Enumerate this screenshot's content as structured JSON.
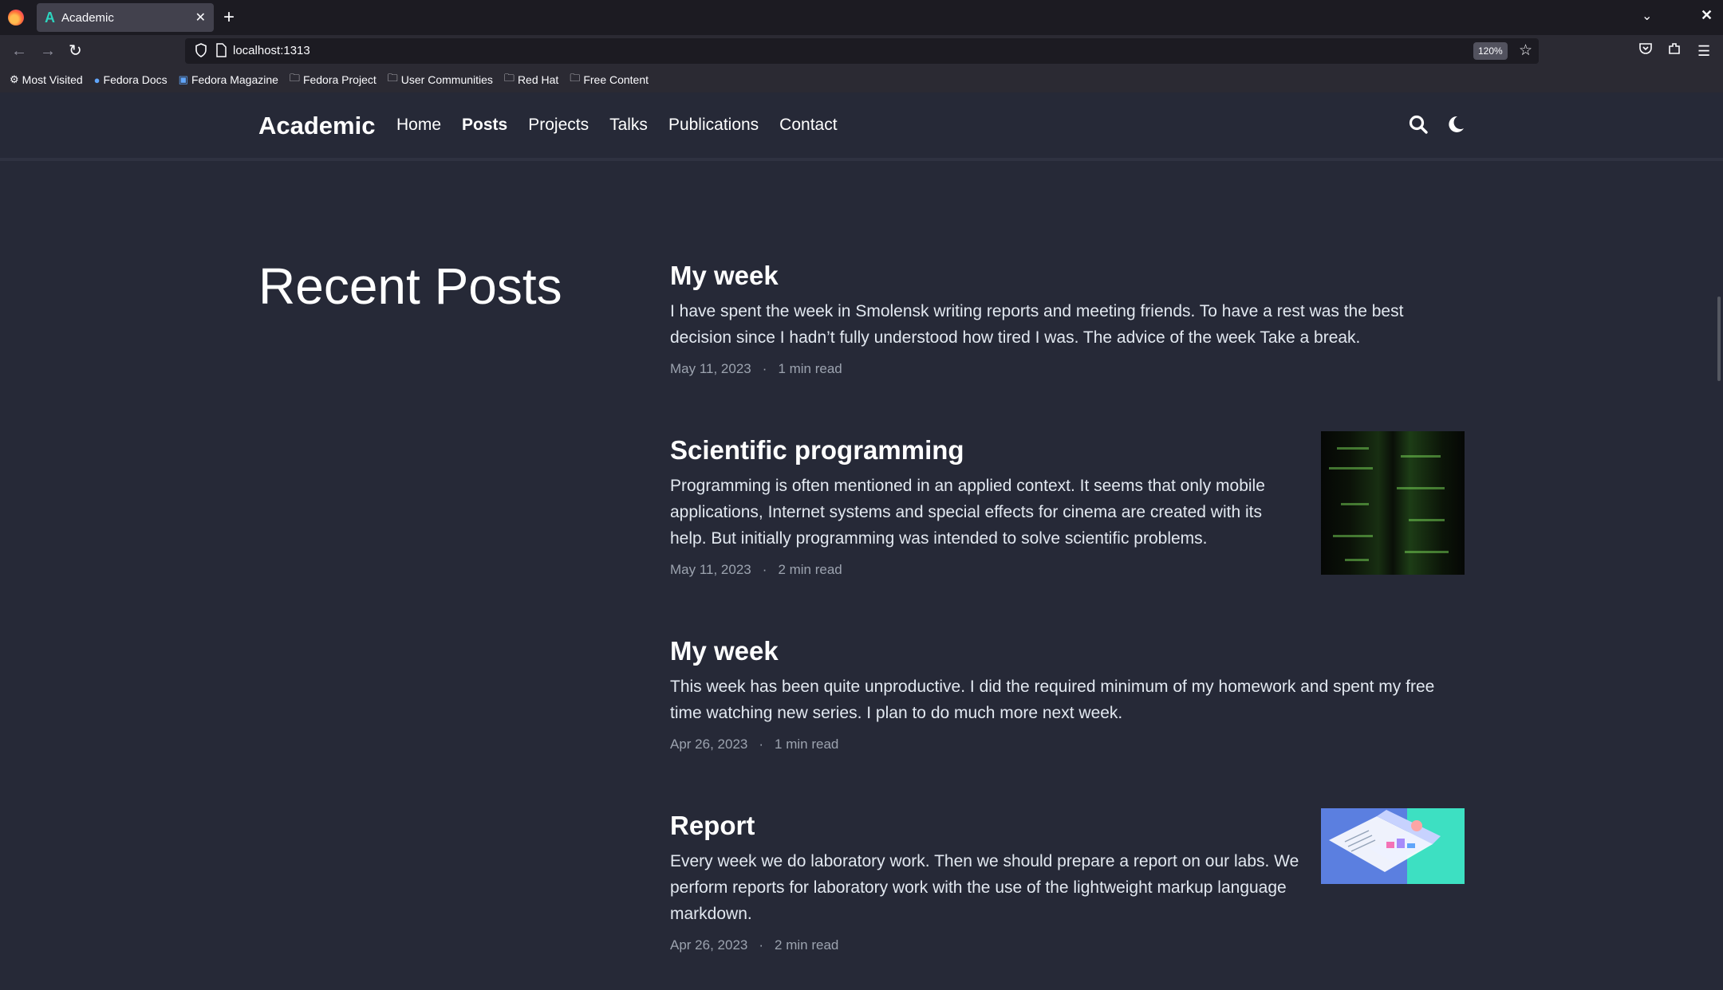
{
  "browser": {
    "tab_title": "Academic",
    "tab_favicon": "A",
    "url": "localhost:1313",
    "zoom": "120%",
    "bookmarks": [
      {
        "label": "Most Visited",
        "icon": "gear-icon"
      },
      {
        "label": "Fedora Docs",
        "icon": "fedora-icon"
      },
      {
        "label": "Fedora Magazine",
        "icon": "fedora-magazine-icon"
      },
      {
        "label": "Fedora Project",
        "icon": "folder-icon"
      },
      {
        "label": "User Communities",
        "icon": "folder-icon"
      },
      {
        "label": "Red Hat",
        "icon": "folder-icon"
      },
      {
        "label": "Free Content",
        "icon": "folder-icon"
      }
    ]
  },
  "site": {
    "brand": "Academic",
    "menu": [
      "Home",
      "Posts",
      "Projects",
      "Talks",
      "Publications",
      "Contact"
    ],
    "active_menu": "Posts"
  },
  "page": {
    "title": "Recent Posts"
  },
  "posts": [
    {
      "title": "My week",
      "summary": "I have spent the week in Smolensk writing reports and meeting friends. To have a rest was the best decision since I hadn’t fully understood how tired I was. The advice of the week Take a break.",
      "date": "May 11, 2023",
      "reading_time": "1 min read"
    },
    {
      "title": "Scientific programming",
      "summary": "Programming is often mentioned in an applied context. It seems that only mobile applications, Internet systems and special effects for cinema are created with its help. But initially programming was intended to solve scientific problems.",
      "date": "May 11, 2023",
      "reading_time": "2 min read",
      "thumbnail": "green-code-server-image"
    },
    {
      "title": "My week",
      "summary": "This week has been quite unproductive. I did the required minimum of my homework and spent my free time watching new series. I plan to do much more next week.",
      "date": "Apr 26, 2023",
      "reading_time": "1 min read"
    },
    {
      "title": "Report",
      "summary": "Every week we do laboratory work. Then we should prepare a report on our labs. We perform reports for laboratory work with the use of the lightweight markup language markdown.",
      "date": "Apr 26, 2023",
      "reading_time": "2 min read",
      "thumbnail": "report-illustration-image"
    }
  ],
  "meta_separator": "·",
  "colors": {
    "page_background": "#262937",
    "heading": "#ffffff",
    "meta": "#9ca3af"
  }
}
